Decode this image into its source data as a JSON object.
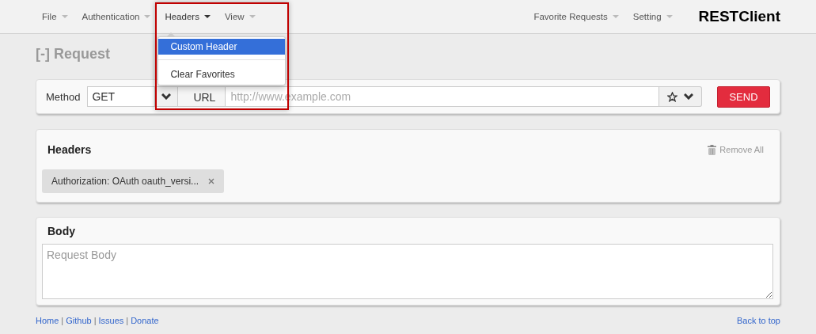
{
  "menu_left": [
    {
      "label": "File",
      "expanded": false
    },
    {
      "label": "Authentication",
      "expanded": false
    },
    {
      "label": "Headers",
      "expanded": true,
      "items": [
        {
          "label": "Custom Header",
          "selected": true
        },
        {
          "label": "Clear Favorites",
          "selected": false
        }
      ]
    },
    {
      "label": "View",
      "expanded": false
    }
  ],
  "menu_right": [
    {
      "label": "Favorite Requests",
      "expanded": false
    },
    {
      "label": "Setting",
      "expanded": false
    }
  ],
  "brand": "RESTClient",
  "request": {
    "title": "[-] Request",
    "method_label": "Method",
    "method": "GET",
    "url_label": "URL",
    "url_placeholder": "http://www.example.com",
    "send": "SEND"
  },
  "headers": {
    "title": "Headers",
    "remove_all": "Remove All",
    "items": [
      {
        "text": "Authorization: OAuth oauth_versi..."
      }
    ]
  },
  "body": {
    "title": "Body",
    "placeholder": "Request Body"
  },
  "footer": {
    "links": [
      "Home",
      "Github",
      "Issues",
      "Donate"
    ],
    "separator": "|",
    "back_to_top": "Back to top"
  }
}
